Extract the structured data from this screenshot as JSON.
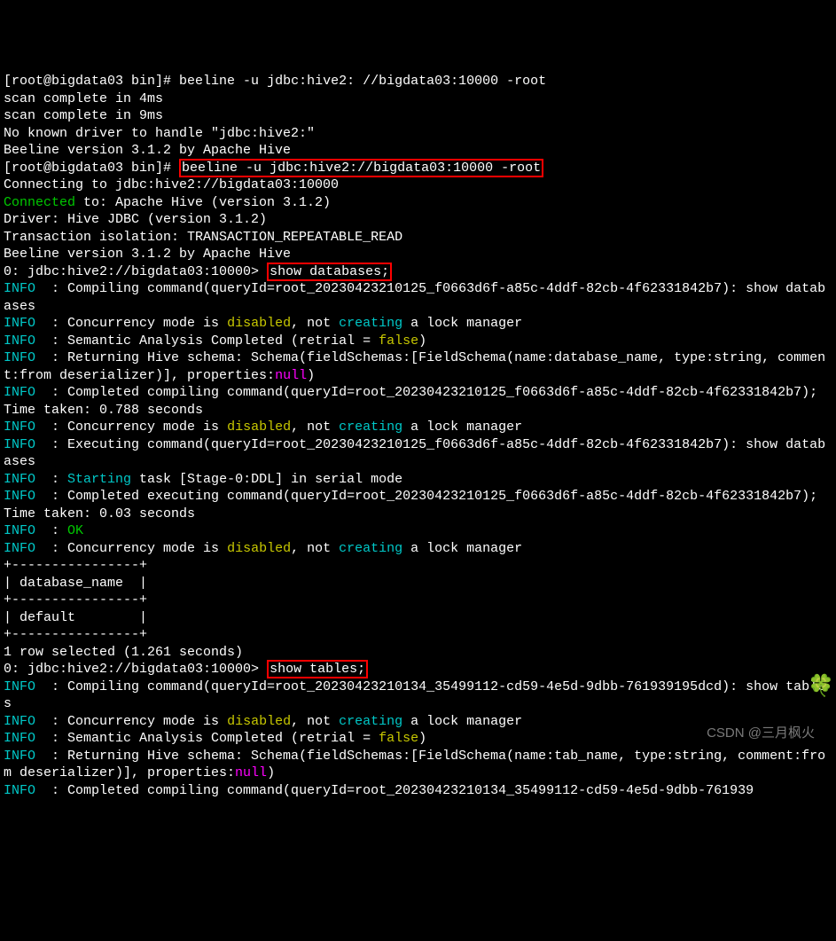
{
  "lines": {
    "l1_prompt": "[root@bigdata03 bin]# ",
    "l1_cmd": "beeline -u jdbc:hive2: //bigdata03:10000 -root",
    "l2": "scan complete in 4ms",
    "l3": "scan complete in 9ms",
    "l4": "No known driver to handle \"jdbc:hive2:\"",
    "l5": "Beeline version 3.1.2 by Apache Hive",
    "l6_prompt": "[root@bigdata03 bin]# ",
    "l6_cmd": "beeline -u jdbc:hive2://bigdata03:10000 -root",
    "l7": "Connecting to jdbc:hive2://bigdata03:10000",
    "l8_a": "Connected",
    "l8_b": " to: Apache Hive (version 3.1.2)",
    "l9": "Driver: Hive JDBC (version 3.1.2)",
    "l10": "Transaction isolation: TRANSACTION_REPEATABLE_READ",
    "l11": "Beeline version 3.1.2 by Apache Hive",
    "l12_prompt": "0: jdbc:hive2://bigdata03:10000> ",
    "l12_cmd": "show databases;",
    "info": "INFO ",
    "l13_a": " : Compiling command(queryId=root_20230423210125_f0663d6f-a85c-4ddf-82cb-4f62331842b7): show databases",
    "l14_a": " : Concurrency mode is ",
    "disabled": "disabled",
    "l14_b": ", not ",
    "creating": "creating",
    "l14_c": " a lock manager",
    "l15_a": " : Semantic Analysis Completed (retrial = ",
    "false": "false",
    "l15_b": ")",
    "l16_a": " : Returning Hive schema: Schema(fieldSchemas:[FieldSchema(name:database_name, type:string, comment:from deserializer)], properties:",
    "null": "null",
    "l16_b": ")",
    "l17_a": " : Completed compiling command(queryId=root_20230423210125_f0663d6f-a85c-4ddf-82cb-4f62331842b7); Time taken: 0.788 seconds",
    "l19_a": " : Executing command(queryId=root_20230423210125_f0663d6f-a85c-4ddf-82cb-4f62331842b7): show databases",
    "l20_a": " : ",
    "starting": "Starting",
    "l20_b": " task [Stage-0:DDL] in serial mode",
    "l21_a": " : Completed executing command(queryId=root_20230423210125_f0663d6f-a85c-4ddf-82cb-4f62331842b7); Time taken: 0.03 seconds",
    "l22_a": " : ",
    "ok": "OK",
    "tbl_sep": "+----------------+",
    "tbl_hdr": "| database_name  |",
    "tbl_row": "| default        |",
    "l24": "1 row selected (1.261 seconds)",
    "l25_prompt": "0: jdbc:hive2://bigdata03:10000> ",
    "l25_cmd": "show tables;",
    "l26_a": " : Compiling command(queryId=root_20230423210134_35499112-cd59-4e5d-9dbb-761939195dcd): show tables",
    "l29_a": " : Returning Hive schema: Schema(fieldSchemas:[FieldSchema(name:tab_name, type:string, comment:from deserializer)], properties:",
    "l30_a": " : Completed compiling command(queryId=root_20230423210134_35499112-cd59-4e5d-9dbb-761939",
    "watermark": "CSDN @三月枫火"
  }
}
